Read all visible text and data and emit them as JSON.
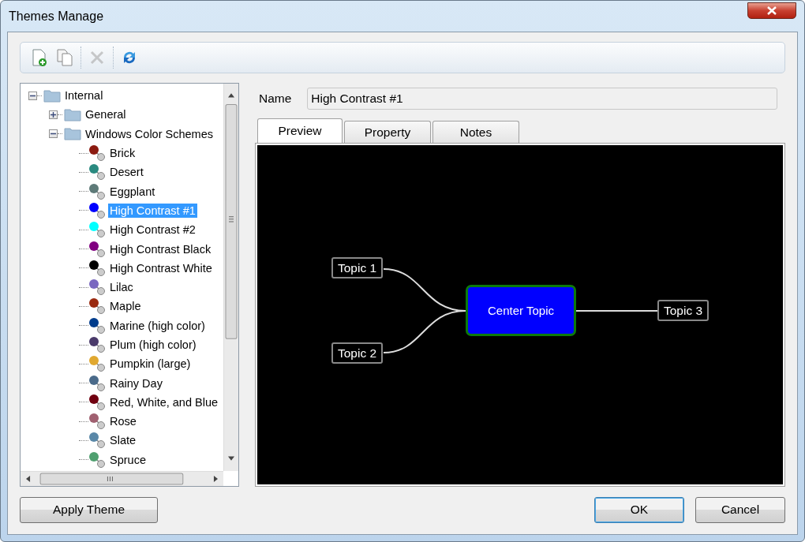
{
  "window": {
    "title": "Themes Manage"
  },
  "toolbar": [
    {
      "kind": "new",
      "disabled": false
    },
    {
      "kind": "copy",
      "disabled": false
    },
    {
      "kind": "delete",
      "disabled": true
    },
    {
      "kind": "refresh",
      "disabled": false
    }
  ],
  "tree": [
    {
      "label": "Internal",
      "expanded": true,
      "selected": false,
      "children": [
        {
          "label": "General",
          "expanded": false,
          "selected": false
        },
        {
          "label": "Windows Color Schemes",
          "expanded": true,
          "selected": false,
          "children": [
            {
              "label": "Brick",
              "color": "#8b1a10",
              "selected": false
            },
            {
              "label": "Desert",
              "color": "#2a8a80",
              "selected": false
            },
            {
              "label": "Eggplant",
              "color": "#5e7a78",
              "selected": false
            },
            {
              "label": "High Contrast #1",
              "color": "#0000ff",
              "selected": true
            },
            {
              "label": "High Contrast #2",
              "color": "#00ffff",
              "selected": false
            },
            {
              "label": "High Contrast Black",
              "color": "#800080",
              "selected": false
            },
            {
              "label": "High Contrast White",
              "color": "#000000",
              "selected": false
            },
            {
              "label": "Lilac",
              "color": "#7a68c0",
              "selected": false
            },
            {
              "label": "Maple",
              "color": "#9a2a10",
              "selected": false
            },
            {
              "label": "Marine (high color)",
              "color": "#003c8c",
              "selected": false
            },
            {
              "label": "Plum (high color)",
              "color": "#4a3a6a",
              "selected": false
            },
            {
              "label": "Pumpkin (large)",
              "color": "#e0a830",
              "selected": false
            },
            {
              "label": "Rainy Day",
              "color": "#4a6a8a",
              "selected": false
            },
            {
              "label": "Red, White, and Blue",
              "color": "#700010",
              "selected": false
            },
            {
              "label": "Rose",
              "color": "#a06070",
              "selected": false
            },
            {
              "label": "Slate",
              "color": "#5a88a8",
              "selected": false
            },
            {
              "label": "Spruce",
              "color": "#50a070",
              "selected": false
            }
          ]
        }
      ]
    }
  ],
  "name_field": {
    "label": "Name",
    "value": "High Contrast #1"
  },
  "tabs": [
    {
      "label": "Preview",
      "selected": true
    },
    {
      "label": "Property",
      "selected": false
    },
    {
      "label": "Notes",
      "selected": false
    }
  ],
  "preview": {
    "nodes": [
      {
        "kind": "center",
        "text": "Center Topic"
      },
      {
        "kind": "topic",
        "text": "Topic 1"
      },
      {
        "kind": "topic",
        "text": "Topic 2"
      },
      {
        "kind": "topic",
        "text": "Topic 3"
      }
    ]
  },
  "buttons": [
    {
      "label": "Apply Theme",
      "default": false
    },
    {
      "label": "OK",
      "default": true
    },
    {
      "label": "Cancel",
      "default": false
    }
  ]
}
